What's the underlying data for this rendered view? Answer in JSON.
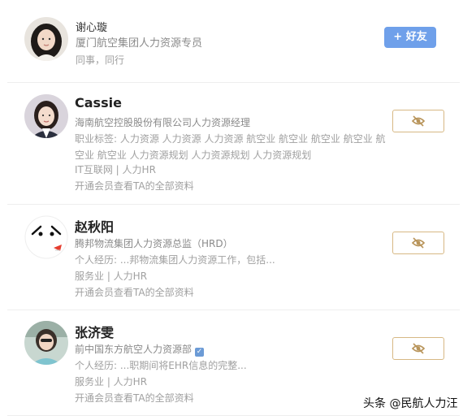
{
  "cards": [
    {
      "name": "谢心璇",
      "title": "厦门航空集团人力资源专员",
      "relation": "同事，同行",
      "action_label": "+ 好友",
      "avatar_icon": "person-photo"
    },
    {
      "name": "Cassie",
      "title": "海南航空控股股份有限公司人力资源经理",
      "tags": "职业标签: 人力资源 人力资源 人力资源 航空业 航空业 航空业 航空业 航空业 航空业 人力资源规划 人力资源规划 人力资源规划",
      "industry": "IT互联网 | 人力HR",
      "vip": "开通会员查看TA的全部资料",
      "action_icon": "eye-slash-icon",
      "avatar_icon": "person-photo"
    },
    {
      "name": "赵秋阳",
      "title": "腾邦物流集团人力资源总监（HRD）",
      "experience": "个人经历: ...邦物流集团人力资源工作，包括...",
      "industry": "服务业 | 人力HR",
      "vip": "开通会员查看TA的全部资料",
      "action_icon": "eye-slash-icon",
      "avatar_icon": "cartoon-avatar"
    },
    {
      "name": "张济雯",
      "title": "前中国东方航空人力资源部",
      "verified_icon": "verified-icon",
      "experience": "个人经历: ...职期间将EHR信息的完整...",
      "industry": "服务业 | 人力HR",
      "vip": "开通会员查看TA的全部资料",
      "action_icon": "eye-slash-icon",
      "avatar_icon": "person-photo"
    }
  ],
  "watermark": "头条 @民航人力汪",
  "colors": {
    "add_button": "#6fa0ea",
    "eye_border": "#d7b884",
    "eye_icon": "#b8945a",
    "name": "#222222",
    "meta": "#a0a0a0"
  }
}
